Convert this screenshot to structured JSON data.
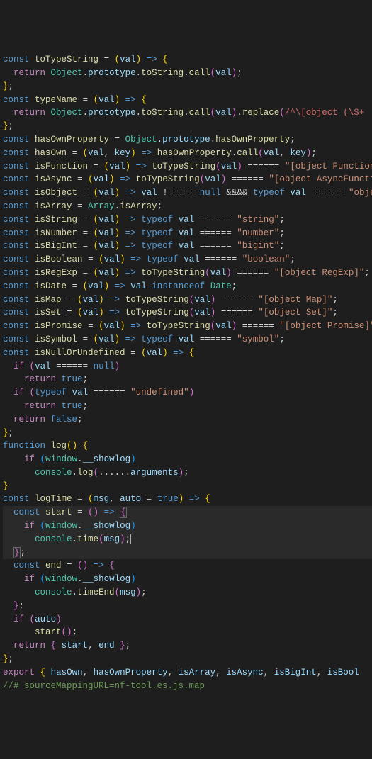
{
  "code": {
    "lines": [
      {
        "t": "decl",
        "name": "toTypeString",
        "params": [
          "val"
        ],
        "arrow": true,
        "open": true
      },
      {
        "t": "return",
        "expr": "Object.prototype.toString.call(val);"
      },
      {
        "t": "close"
      },
      {
        "t": "decl",
        "name": "typeName",
        "params": [
          "val"
        ],
        "arrow": true,
        "open": true
      },
      {
        "t": "return",
        "expr": "Object.prototype.toString.call(val).replace(/^\\[object (\\S+",
        "truncated": true
      },
      {
        "t": "close"
      },
      {
        "t": "decl-assign",
        "name": "hasOwnProperty",
        "rhs": "Object.prototype.hasOwnProperty;"
      },
      {
        "t": "decl",
        "name": "hasOwn",
        "params": [
          "val",
          "key"
        ],
        "arrow_expr": "hasOwnProperty.call(val, key);"
      },
      {
        "t": "decl",
        "name": "isFunction",
        "params": [
          "val"
        ],
        "arrow_expr": "toTypeString(val) === \"[object Function",
        "truncated": true
      },
      {
        "t": "decl",
        "name": "isAsync",
        "params": [
          "val"
        ],
        "arrow_expr": "toTypeString(val) === \"[object AsyncFunctio",
        "truncated": true
      },
      {
        "t": "decl",
        "name": "isObject",
        "params": [
          "val"
        ],
        "arrow_expr": "val !== null && typeof val === \"object\";"
      },
      {
        "t": "decl-assign",
        "name": "isArray",
        "rhs": "Array.isArray;"
      },
      {
        "t": "decl",
        "name": "isString",
        "params": [
          "val"
        ],
        "arrow_expr": "typeof val === \"string\";"
      },
      {
        "t": "decl",
        "name": "isNumber",
        "params": [
          "val"
        ],
        "arrow_expr": "typeof val === \"number\";"
      },
      {
        "t": "decl",
        "name": "isBigInt",
        "params": [
          "val"
        ],
        "arrow_expr": "typeof val === \"bigint\";"
      },
      {
        "t": "decl",
        "name": "isBoolean",
        "params": [
          "val"
        ],
        "arrow_expr": "typeof val === \"boolean\";"
      },
      {
        "t": "decl",
        "name": "isRegExp",
        "params": [
          "val"
        ],
        "arrow_expr": "toTypeString(val) === \"[object RegExp]\";"
      },
      {
        "t": "decl",
        "name": "isDate",
        "params": [
          "val"
        ],
        "arrow_expr": "val instanceof Date;"
      },
      {
        "t": "decl",
        "name": "isMap",
        "params": [
          "val"
        ],
        "arrow_expr": "toTypeString(val) === \"[object Map]\";"
      },
      {
        "t": "decl",
        "name": "isSet",
        "params": [
          "val"
        ],
        "arrow_expr": "toTypeString(val) === \"[object Set]\";"
      },
      {
        "t": "decl",
        "name": "isPromise",
        "params": [
          "val"
        ],
        "arrow_expr": "toTypeString(val) === \"[object Promise]\"",
        "truncated": true
      },
      {
        "t": "decl",
        "name": "isSymbol",
        "params": [
          "val"
        ],
        "arrow_expr": "typeof val === \"symbol\";"
      },
      {
        "t": "decl",
        "name": "isNullOrUndefined",
        "params": [
          "val"
        ],
        "arrow": true,
        "open": true
      },
      {
        "t": "if",
        "cond": "val === null"
      },
      {
        "t": "return-kw",
        "val": "true"
      },
      {
        "t": "if",
        "cond": "typeof val === \"undefined\""
      },
      {
        "t": "return-kw",
        "val": "true"
      },
      {
        "t": "return-kw",
        "val": "false"
      },
      {
        "t": "close"
      },
      {
        "t": "fn-decl",
        "name": "log",
        "params": []
      },
      {
        "t": "if-inline",
        "cond": "window.__showlog"
      },
      {
        "t": "stmt",
        "body": "console.log(...arguments);"
      },
      {
        "t": "close-fn"
      },
      {
        "t": "decl",
        "name": "logTime",
        "params": [
          "msg",
          "auto = true"
        ],
        "arrow": true,
        "open": true
      },
      {
        "t": "decl-inner",
        "name": "start",
        "params": [],
        "arrow": true,
        "open": true,
        "hl": true,
        "cursorbox": true
      },
      {
        "t": "if-inline",
        "cond": "window.__showlog",
        "hl": true
      },
      {
        "t": "stmt",
        "body": "console.time(msg);",
        "hl": true,
        "cursor": true
      },
      {
        "t": "close-inner",
        "hl": true,
        "cursorbox2": true
      },
      {
        "t": "decl-inner",
        "name": "end",
        "params": [],
        "arrow": true,
        "open": true
      },
      {
        "t": "if-inline",
        "cond": "window.__showlog"
      },
      {
        "t": "stmt",
        "body": "console.timeEnd(msg);"
      },
      {
        "t": "close-inner"
      },
      {
        "t": "if-inline-hdr",
        "cond": "auto"
      },
      {
        "t": "stmt",
        "body": "start();"
      },
      {
        "t": "return-obj",
        "props": [
          "start",
          "end"
        ]
      },
      {
        "t": "close"
      },
      {
        "t": "export",
        "names": [
          "hasOwn",
          "hasOwnProperty",
          "isArray",
          "isAsync",
          "isBigInt",
          "isBool"
        ],
        "truncated": true
      },
      {
        "t": "comment",
        "text": "//# sourceMappingURL=nf-tool.es.js.map"
      }
    ]
  }
}
